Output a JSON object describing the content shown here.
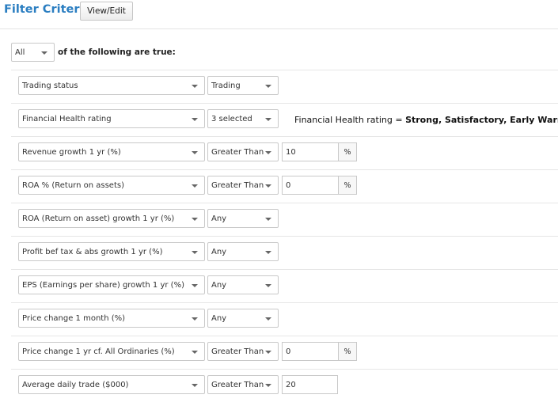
{
  "header": {
    "title": "Filter Criteria",
    "view_edit_label": "View/Edit"
  },
  "logic": {
    "selected": "All",
    "text": "of the following are true:"
  },
  "criteria": [
    {
      "field": "Trading status",
      "operator": "Trading"
    },
    {
      "field": "Financial Health rating",
      "operator": "3 selected",
      "summary_prefix": "Financial Health rating = ",
      "summary_values": "Strong, Satisfactory, Early Warning"
    },
    {
      "field": "Revenue growth 1 yr (%)",
      "operator": "Greater Than",
      "value": "10",
      "unit": "%"
    },
    {
      "field": "ROA % (Return on assets)",
      "operator": "Greater Than",
      "value": "0",
      "unit": "%"
    },
    {
      "field": "ROA (Return on asset) growth 1 yr (%)",
      "operator": "Any"
    },
    {
      "field": "Profit bef tax & abs growth 1 yr (%)",
      "operator": "Any"
    },
    {
      "field": "EPS (Earnings per share) growth 1 yr (%)",
      "operator": "Any"
    },
    {
      "field": "Price change 1 month (%)",
      "operator": "Any"
    },
    {
      "field": "Price change 1 yr cf. All Ordinaries (%)",
      "operator": "Greater Than",
      "value": "0",
      "unit": "%"
    },
    {
      "field": "Average daily trade ($000)",
      "operator": "Greater Than",
      "value": "20"
    }
  ]
}
